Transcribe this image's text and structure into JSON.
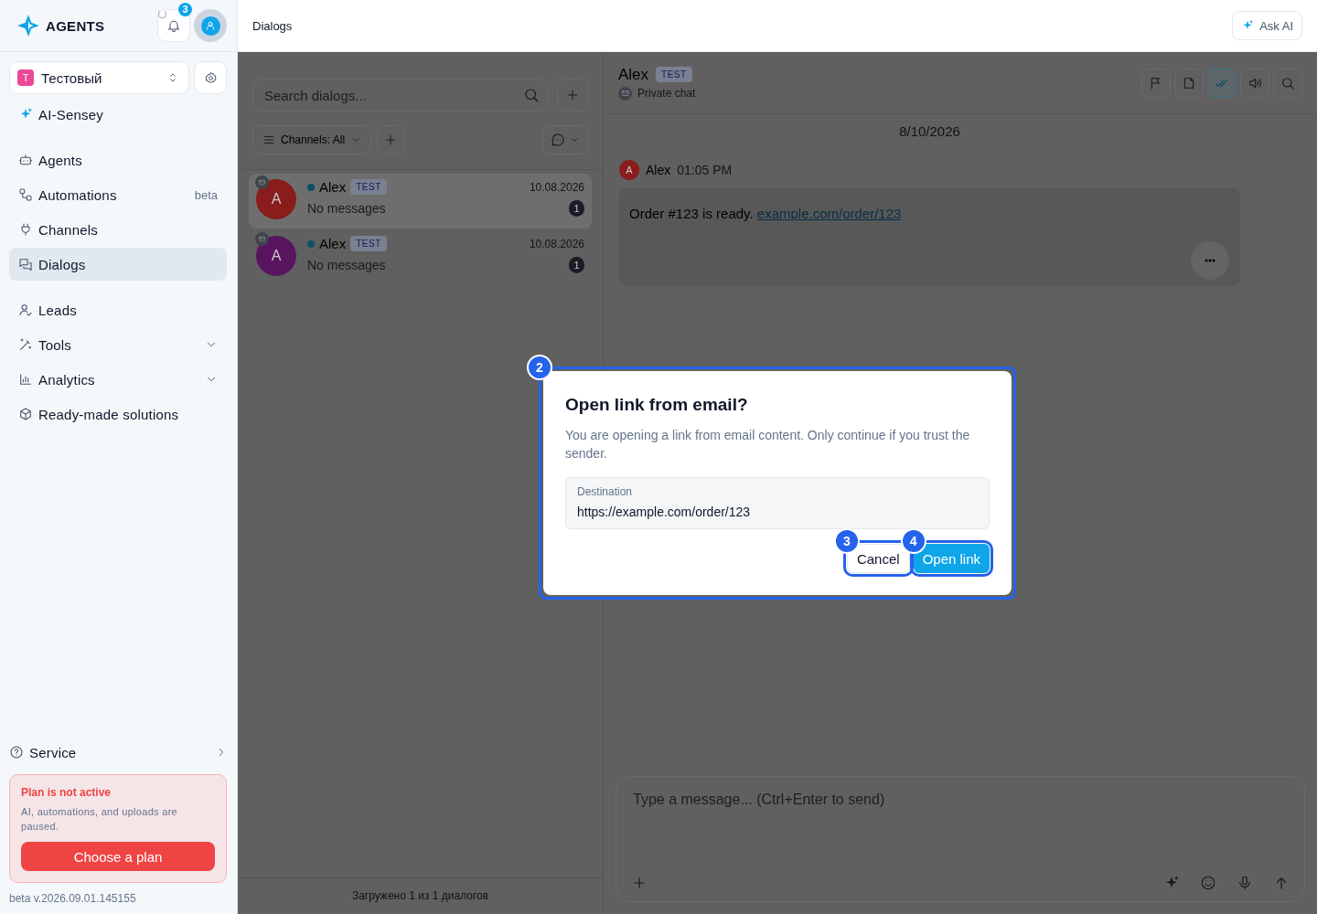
{
  "brand": {
    "name": "AGENTS"
  },
  "header": {
    "notification_count": "3",
    "loading": true,
    "page_title": "Dialogs",
    "ask_ai": "Ask AI"
  },
  "workspace": {
    "initial": "T",
    "name": "Тестовый"
  },
  "sidebar": {
    "sections": [
      [
        {
          "label": "AI-Sensey",
          "selected": false,
          "submenu": false
        }
      ],
      [
        {
          "label": "Agents",
          "selected": false,
          "submenu": false
        },
        {
          "label": "Automations",
          "badge": "beta",
          "selected": false,
          "submenu": false
        },
        {
          "label": "Channels",
          "selected": false,
          "submenu": false
        },
        {
          "label": "Dialogs",
          "selected": true,
          "submenu": false
        }
      ],
      [
        {
          "label": "Leads",
          "selected": false,
          "submenu": false
        },
        {
          "label": "Tools",
          "selected": false,
          "submenu": true
        },
        {
          "label": "Analytics",
          "selected": false,
          "submenu": true
        },
        {
          "label": "Ready-made solutions",
          "selected": false,
          "submenu": false
        }
      ]
    ],
    "service": {
      "label": "Service"
    },
    "plan_notice": {
      "title": "Plan is not active",
      "text": "AI, automations, and uploads are paused.",
      "button": "Choose a plan"
    },
    "version": "beta v.2026.09.01.145155"
  },
  "dialog_list": {
    "search": {
      "placeholder": "Search dialogs..."
    },
    "channel_filter": "Channels: All",
    "dialogs": [
      {
        "initial": "A",
        "color": "#8a1c1c",
        "online": true,
        "name": "Alex",
        "tag": "TEST",
        "date": "10.08.2026",
        "preview": "No messages",
        "unread": "1",
        "selected": true
      },
      {
        "initial": "A",
        "color": "#58145f",
        "online": true,
        "name": "Alex",
        "tag": "TEST",
        "date": "10.08.2026",
        "preview": "No messages",
        "unread": "1",
        "selected": false
      }
    ],
    "footer": "Загружено 1 из 1 диалогов"
  },
  "chat": {
    "name": "Alex",
    "tag": "TEST",
    "subtitle": "Private chat",
    "read_filter_on": true,
    "date": "8/10/2026",
    "messages": [
      {
        "initial": "A",
        "sender": "Alex",
        "time": "01:05 PM",
        "text": "Order #123 is ready. ",
        "link": "example.com/order/123"
      }
    ],
    "composer": {
      "placeholder": "Type a message... (Ctrl+Enter to send)"
    }
  },
  "modal": {
    "marker": "2",
    "title": "Open link from email?",
    "text": "You are opening a link from email content. Only continue if you trust the sender.",
    "field": {
      "label": "Destination",
      "value": "https://example.com/order/123"
    },
    "buttons": [
      {
        "kind": "secondary",
        "label": "Cancel",
        "marker": "3"
      },
      {
        "kind": "primary",
        "label": "Open link",
        "marker": "4"
      }
    ]
  }
}
